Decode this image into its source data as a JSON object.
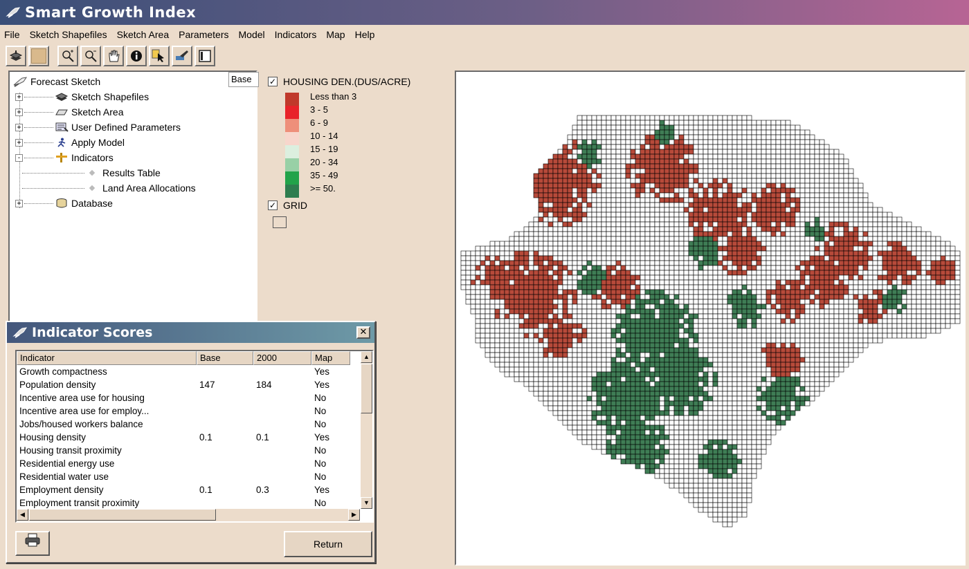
{
  "window": {
    "title": "Smart Growth Index"
  },
  "menu": [
    {
      "label": "File"
    },
    {
      "label": "Sketch Shapefiles"
    },
    {
      "label": "Sketch Area"
    },
    {
      "label": "Parameters"
    },
    {
      "label": "Model"
    },
    {
      "label": "Indicators"
    },
    {
      "label": "Map"
    },
    {
      "label": "Help"
    }
  ],
  "toolbar": {
    "buttons": [
      "layers-icon",
      "color-swatch",
      "zoom-in-icon",
      "zoom-out-icon",
      "pan-hand-icon",
      "info-icon",
      "select-arrow-icon",
      "paint-icon",
      "frame-icon"
    ]
  },
  "tree": {
    "root": "Forecast Sketch",
    "base_tab": "Base",
    "items": [
      {
        "label": "Sketch Shapefiles",
        "expander": "+"
      },
      {
        "label": "Sketch Area",
        "expander": "+"
      },
      {
        "label": "User Defined Parameters",
        "expander": "+"
      },
      {
        "label": "Apply Model",
        "expander": "+"
      },
      {
        "label": "Indicators",
        "expander": "-"
      },
      {
        "label": "Results Table",
        "child": true
      },
      {
        "label": "Land Area Allocations",
        "child": true
      },
      {
        "label": "Database",
        "expander": "+"
      }
    ]
  },
  "legend": {
    "layer_title": "HOUSING DEN.(DUS/ACRE)",
    "layer_checked": "✓",
    "classes": [
      {
        "label": "Less than 3",
        "color": "#c0392b"
      },
      {
        "label": "3 - 5",
        "color": "#e8232a"
      },
      {
        "label": "6 - 9",
        "color": "#ee8f7a"
      },
      {
        "label": "10 - 14",
        "color": "#f7d6cc"
      },
      {
        "label": "15 - 19",
        "color": "#dcefdf"
      },
      {
        "label": "20 - 34",
        "color": "#98d0a6"
      },
      {
        "label": "35 - 49",
        "color": "#22a34a"
      },
      {
        "label": ">= 50.",
        "color": "#2e7d4f"
      }
    ],
    "grid_title": "GRID",
    "grid_checked": "✓"
  },
  "map_colors": {
    "red": "#b74a3a",
    "green": "#3f7d55",
    "empty": "#ffffff",
    "grid": "#000000"
  },
  "indicator_window": {
    "title": "Indicator Scores",
    "close": "✕",
    "columns": [
      "Indicator",
      "Base",
      "2000",
      "Map"
    ],
    "rows": [
      [
        "Growth compactness",
        "",
        "",
        "Yes"
      ],
      [
        "Population density",
        "147",
        "184",
        "Yes"
      ],
      [
        "Incentive area use for housing",
        "",
        "",
        "No"
      ],
      [
        "Incentive area use for employ...",
        "",
        "",
        "No"
      ],
      [
        "Jobs/housed workers balance",
        "",
        "",
        "No"
      ],
      [
        "Housing density",
        "0.1",
        "0.1",
        "Yes"
      ],
      [
        "Housing transit proximity",
        "",
        "",
        "No"
      ],
      [
        "Residential energy use",
        "",
        "",
        "No"
      ],
      [
        "Residential water use",
        "",
        "",
        "No"
      ],
      [
        "Employment density",
        "0.1",
        "0.3",
        "Yes"
      ],
      [
        "Employment transit proximity",
        "",
        "",
        "No"
      ]
    ],
    "return_label": "Return"
  }
}
